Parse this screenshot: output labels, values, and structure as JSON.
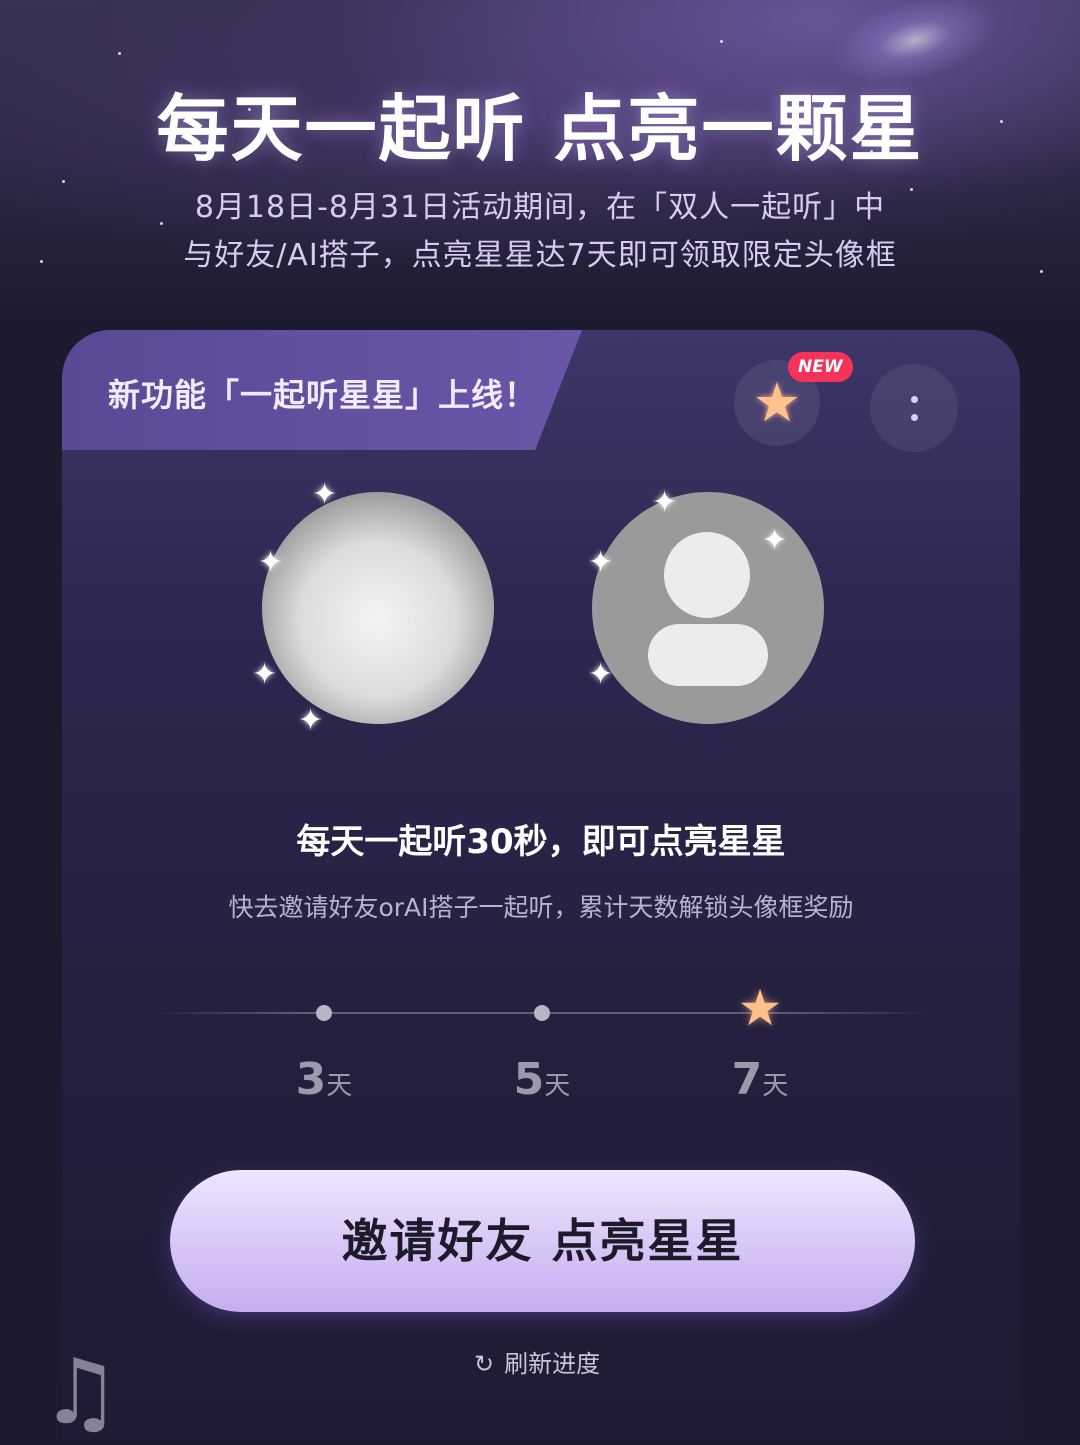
{
  "header": {
    "headline": "每天一起听 点亮一颗星",
    "subtitle_line1": "8月18日-8月31日活动期间，在「双人一起听」中",
    "subtitle_line2": "与好友/AI搭子，点亮星星达7天即可领取限定头像框"
  },
  "card": {
    "banner": "新功能「一起听星星」上线！",
    "new_badge": "NEW",
    "title": "每天一起听30秒，即可点亮星星",
    "description": "快去邀请好友orAI搭子一起听，累计天数解锁头像框奖励"
  },
  "milestones": [
    {
      "num": "3",
      "unit": "天",
      "state": "dot"
    },
    {
      "num": "5",
      "unit": "天",
      "state": "dot"
    },
    {
      "num": "7",
      "unit": "天",
      "state": "star"
    }
  ],
  "actions": {
    "cta_label": "邀请好友 点亮星星",
    "refresh_label": "刷新进度"
  },
  "icons": {
    "star": "star-icon",
    "more": "more-vertical-icon",
    "refresh": "refresh-icon",
    "music": "music-note-icon"
  },
  "colors": {
    "background": "#1c1a2e",
    "card": "#2d2851",
    "banner": "#5a4a95",
    "cta": "#d8c5f6",
    "badge": "#f5325a",
    "star": "#ffc08a"
  }
}
